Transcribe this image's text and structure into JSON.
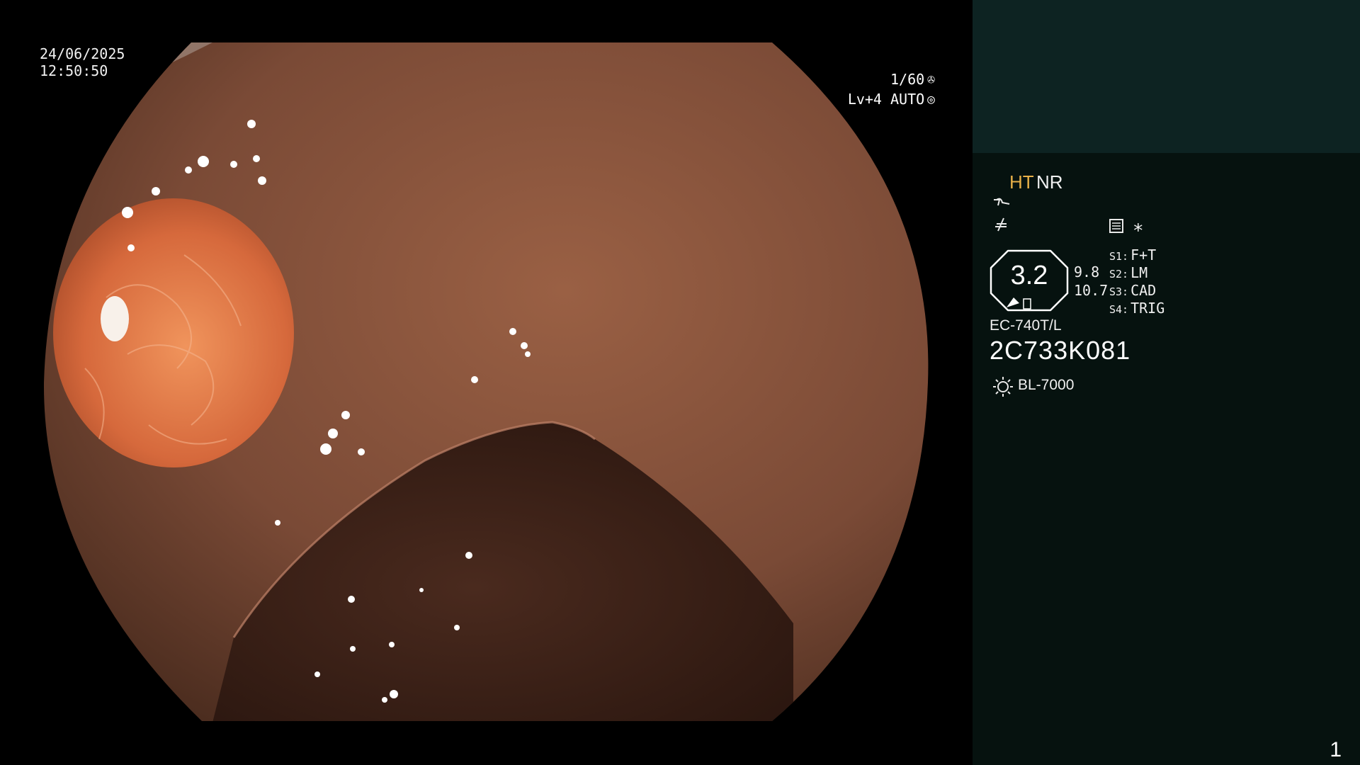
{
  "image": {
    "date": "24/06/2025",
    "time": "12:50:50",
    "shutter": "1/60",
    "shutter_icon": "aperture-icon",
    "level": "Lv+4",
    "exposure_mode": "AUTO",
    "exposure_icon": "iris-icon"
  },
  "panel": {
    "modes": {
      "ht": "HT",
      "nr": "NR"
    },
    "enhance_icon": "edge-enhance-icon",
    "color_icon": "color-tone-icon",
    "memo_icon": "menu-list-icon",
    "star": "∗",
    "zoom": {
      "value": "3.2",
      "upper": "9.8",
      "lower": "10.7"
    },
    "switches": [
      {
        "key": "S1:",
        "value": "F+T"
      },
      {
        "key": "S2:",
        "value": "LM"
      },
      {
        "key": "S3:",
        "value": "CAD"
      },
      {
        "key": "S4:",
        "value": "TRIG"
      }
    ],
    "scope_model": "EC-740T/L",
    "scope_serial": "2C733K081",
    "light_source": "BL-7000",
    "light_icon": "light-source-icon",
    "frame_number": "1"
  },
  "colors": {
    "panel_bg": "#06120f",
    "panel_top": "#0d2322",
    "mode_accent": "#e8b048",
    "tissue": "#7a4a36",
    "polyp": "#e07a4c"
  }
}
